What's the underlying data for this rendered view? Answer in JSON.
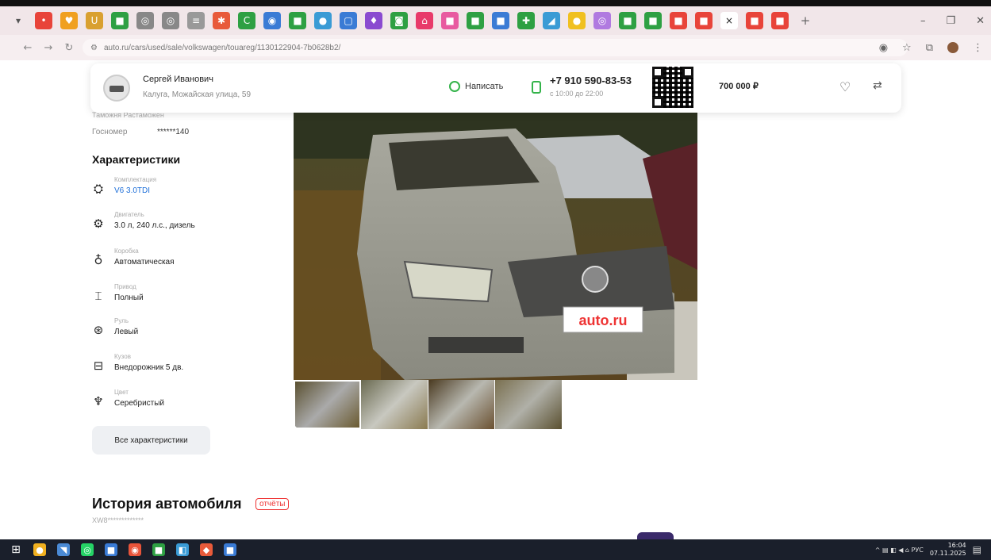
{
  "browser": {
    "tabs": [
      {
        "color": "#e8443a",
        "glyph": "•"
      },
      {
        "color": "#f0a020",
        "glyph": "♥"
      },
      {
        "color": "#d9a030",
        "glyph": "U"
      },
      {
        "color": "#2ea043",
        "glyph": "■"
      },
      {
        "color": "#888888",
        "glyph": "◎"
      },
      {
        "color": "#888888",
        "glyph": "◎"
      },
      {
        "color": "#999999",
        "glyph": "≡"
      },
      {
        "color": "#e85a3a",
        "glyph": "✱"
      },
      {
        "color": "#2ea043",
        "glyph": "C"
      },
      {
        "color": "#3a7bd5",
        "glyph": "◉"
      },
      {
        "color": "#2ea043",
        "glyph": "■"
      },
      {
        "color": "#3a9bd5",
        "glyph": "●"
      },
      {
        "color": "#3a7bd5",
        "glyph": "▢"
      },
      {
        "color": "#8a4ad0",
        "glyph": "♦"
      },
      {
        "color": "#2ea043",
        "glyph": "◙"
      },
      {
        "color": "#e83a6a",
        "glyph": "⌂"
      },
      {
        "color": "#e85aa0",
        "glyph": "■"
      },
      {
        "color": "#2ea043",
        "glyph": "■"
      },
      {
        "color": "#3a7bd5",
        "glyph": "■"
      },
      {
        "color": "#2ea043",
        "glyph": "✚"
      },
      {
        "color": "#3a9bd5",
        "glyph": "◢"
      },
      {
        "color": "#f0c020",
        "glyph": "●"
      },
      {
        "color": "#b07ae0",
        "glyph": "◎"
      },
      {
        "color": "#2ea043",
        "glyph": "■"
      },
      {
        "color": "#2ea043",
        "glyph": "■"
      },
      {
        "color": "#e8443a",
        "glyph": "■"
      },
      {
        "color": "#e8443a",
        "glyph": "■"
      }
    ],
    "active_tab": {
      "glyph": "×"
    },
    "tabs_after": [
      {
        "color": "#e8443a",
        "glyph": "■"
      },
      {
        "color": "#e8443a",
        "glyph": "■"
      }
    ],
    "new_tab": "+",
    "window_controls": {
      "minimize": "–",
      "restore": "❐",
      "close": "✕"
    },
    "nav": {
      "back": "←",
      "forward": "→",
      "reload": "↻"
    },
    "url": "auto.ru/cars/used/sale/volkswagen/touareg/1130122904-7b0628b2/",
    "url_icons": {
      "eye": "◉",
      "star": "☆",
      "extensions": "⧉",
      "menu": "⋮"
    }
  },
  "seller": {
    "name": "Сергей Иванович",
    "address": "Калуга, Можайская улица, 59",
    "write_label": "Написать",
    "phone": "+7 910 590-83-53",
    "phone_hours": "с 10:00 до 22:00",
    "price": "700 000 ₽",
    "heart": "♡",
    "compare": "⇄"
  },
  "specs": {
    "faded_row": "Таможня    Растаможен",
    "gosnomer_label": "Госномер",
    "gosnomer_value": "******140",
    "title": "Характеристики",
    "rows": [
      {
        "icon": "⛭",
        "label": "Комплектация",
        "value": "V6 3.0TDI",
        "link": true
      },
      {
        "icon": "⚙",
        "label": "Двигатель",
        "value": "3.0 л, 240 л.с., дизель",
        "link": false
      },
      {
        "icon": "♁",
        "label": "Коробка",
        "value": "Автоматическая",
        "link": false
      },
      {
        "icon": "⌶",
        "label": "Привод",
        "value": "Полный",
        "link": false
      },
      {
        "icon": "⊛",
        "label": "Руль",
        "value": "Левый",
        "link": false
      },
      {
        "icon": "⊟",
        "label": "Кузов",
        "value": "Внедорожник 5 дв.",
        "link": false
      },
      {
        "icon": "♆",
        "label": "Цвет",
        "value": "Серебристый",
        "link": false
      }
    ],
    "all_button": "Все характеристики"
  },
  "photo": {
    "plate_text": "auto.ru",
    "thumbnails": 4
  },
  "history": {
    "title": "История автомобиля",
    "badge": "отчёты",
    "vin": "XW8*************"
  },
  "taskbar": {
    "start": "⊞",
    "apps": [
      {
        "color": "#f0b020",
        "glyph": "●"
      },
      {
        "color": "#4a8ad5",
        "glyph": "◥"
      },
      {
        "color": "#25d366",
        "glyph": "◎"
      },
      {
        "color": "#3a7bd5",
        "glyph": "■"
      },
      {
        "color": "#e8543a",
        "glyph": "◉"
      },
      {
        "color": "#2ea043",
        "glyph": "■"
      },
      {
        "color": "#3a9bd5",
        "glyph": "◧"
      },
      {
        "color": "#e85a3a",
        "glyph": "◆"
      },
      {
        "color": "#3a7bd5",
        "glyph": "■"
      }
    ],
    "tray": "^ ▤ ◧ ◀ ⌂ РУС",
    "time": "16:04",
    "date": "07.11.2025",
    "notif": "▤"
  }
}
